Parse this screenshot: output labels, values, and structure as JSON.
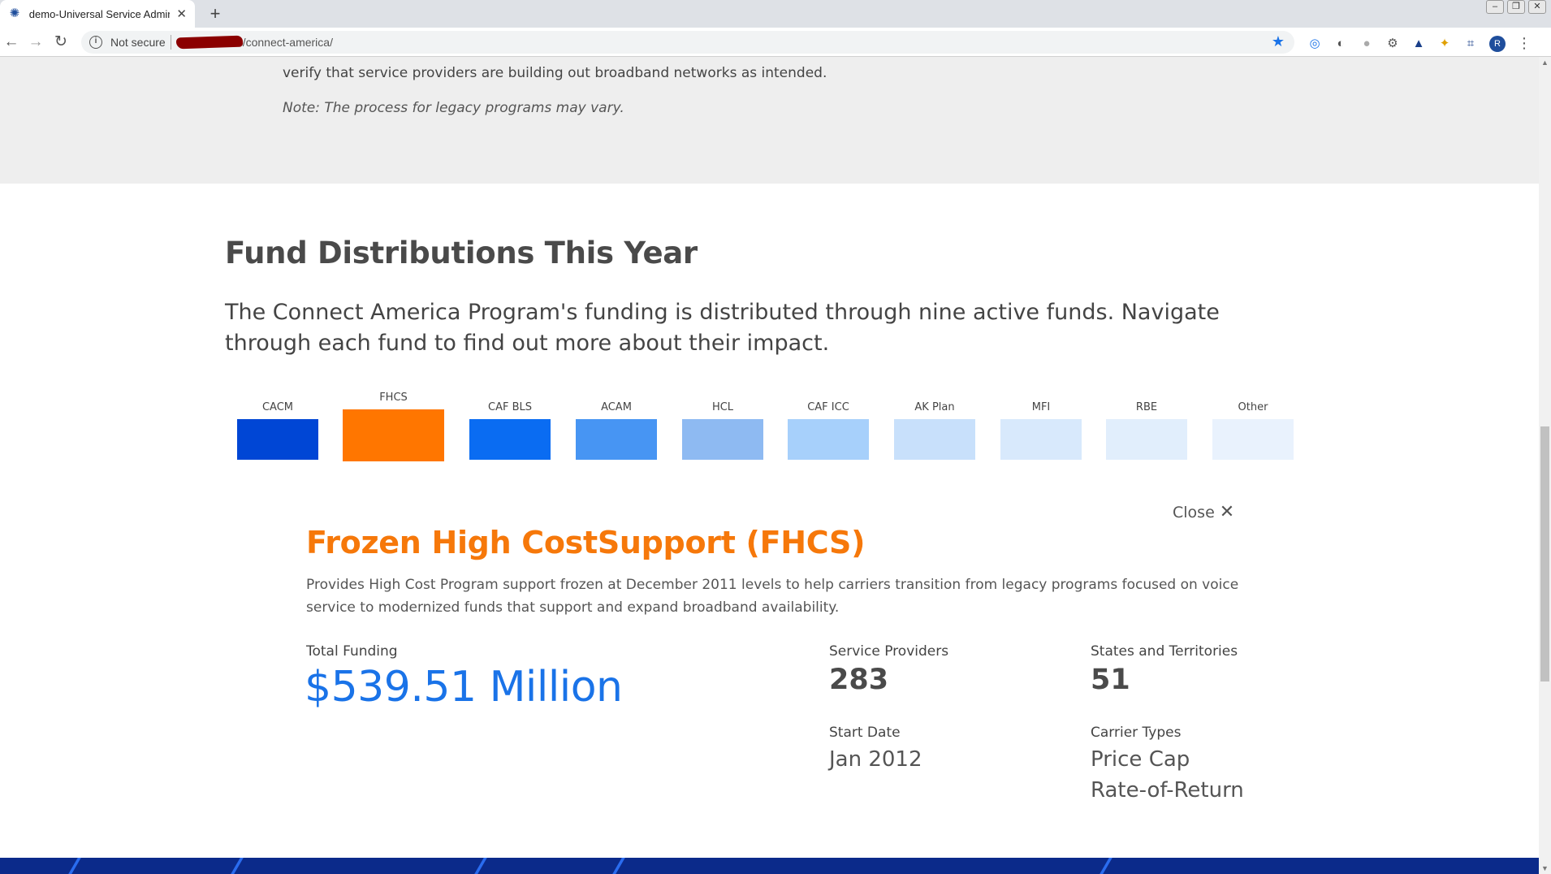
{
  "browser": {
    "tab_title": "demo-Universal Service Administ",
    "security_label": "Not secure",
    "url_path": "/connect-america/",
    "profile_initial": "R"
  },
  "gray": {
    "text": "verify that service providers are building out broadband networks as intended.",
    "note": "Note: The process for legacy programs may vary."
  },
  "section": {
    "title": "Fund Distributions This Year",
    "intro": "The Connect America Program's funding is distributed through nine active funds. Navigate through each fund to find out more about their impact."
  },
  "funds": [
    {
      "label": "CACM",
      "color": "#0046d5"
    },
    {
      "label": "FHCS",
      "color": "#ff7600",
      "selected": true
    },
    {
      "label": "CAF BLS",
      "color": "#0a6cf2"
    },
    {
      "label": "ACAM",
      "color": "#4795f3"
    },
    {
      "label": "HCL",
      "color": "#8ebaf2"
    },
    {
      "label": "CAF ICC",
      "color": "#a7d0fb"
    },
    {
      "label": "AK Plan",
      "color": "#c8e0fb"
    },
    {
      "label": "MFI",
      "color": "#d8e9fc"
    },
    {
      "label": "RBE",
      "color": "#e1eefc"
    },
    {
      "label": "Other",
      "color": "#e9f2fd"
    }
  ],
  "detail": {
    "close_label": "Close",
    "title": "Frozen High CostSupport (FHCS)",
    "description": "Provides High Cost Program support frozen at December 2011 levels to help carriers transition from legacy programs focused on voice service to modernized funds that support and expand broadband availability.",
    "total_funding_label": "Total Funding",
    "total_funding_value": "$539.51 Million",
    "providers_label": "Service Providers",
    "providers_value": "283",
    "states_label": "States and Territories",
    "states_value": "51",
    "start_label": "Start Date",
    "start_value": "Jan 2012",
    "carrier_label": "Carrier Types",
    "carrier_types": [
      "Price Cap",
      "Rate-of-Return"
    ]
  }
}
